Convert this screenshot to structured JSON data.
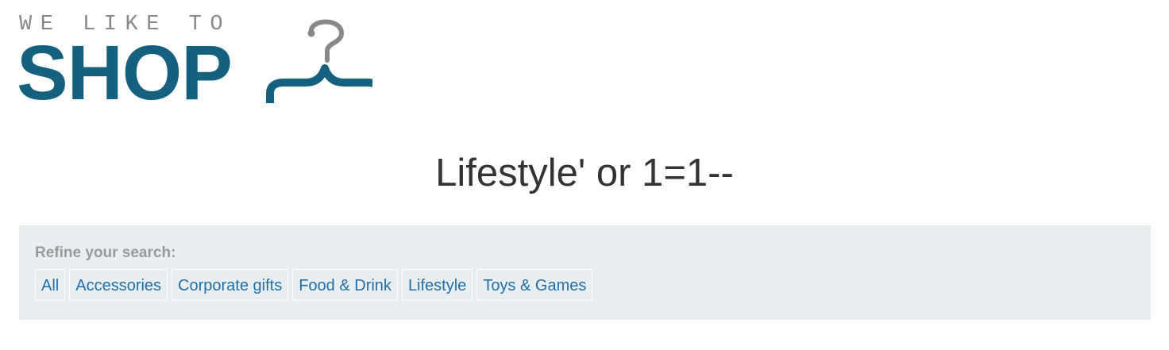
{
  "logo": {
    "tagline": "WE LIKE TO",
    "word": "SHOP",
    "icon": "clothes-hanger-icon",
    "colors": {
      "word": "#15607f",
      "tagline": "#888888",
      "hanger_hook": "#888888",
      "hanger_body": "#15607f"
    }
  },
  "heading": "Lifestyle' or 1=1--",
  "filters": {
    "label": "Refine your search:",
    "items": [
      {
        "label": "All"
      },
      {
        "label": "Accessories"
      },
      {
        "label": "Corporate gifts"
      },
      {
        "label": "Food & Drink"
      },
      {
        "label": "Lifestyle"
      },
      {
        "label": "Toys & Games"
      }
    ],
    "colors": {
      "panel_background": "#e9eef1",
      "link": "#1f6fa7",
      "label": "#999999"
    }
  }
}
